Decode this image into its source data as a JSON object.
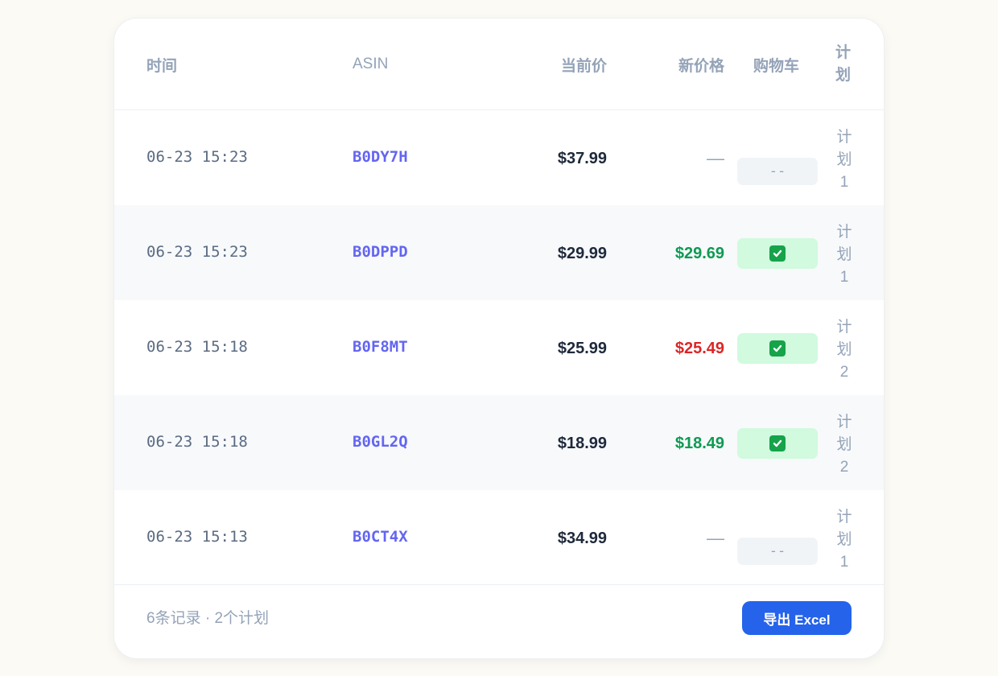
{
  "table": {
    "headers": {
      "time": "时间",
      "asin": "ASIN",
      "current_price": "当前价",
      "new_price": "新价格",
      "cart": "购物车",
      "plan": "计划"
    },
    "rows": [
      {
        "time": "06-23 15:23",
        "asin": "B0DY7H",
        "current_price": "$37.99",
        "new_price": "—",
        "new_price_status": "none",
        "cart": "--",
        "cart_status": "none",
        "plan": "计划1"
      },
      {
        "time": "06-23 15:23",
        "asin": "B0DPPD",
        "current_price": "$29.99",
        "new_price": "$29.69",
        "new_price_status": "green",
        "cart": "check",
        "cart_status": "yes",
        "plan": "计划1"
      },
      {
        "time": "06-23 15:18",
        "asin": "B0F8MT",
        "current_price": "$25.99",
        "new_price": "$25.49",
        "new_price_status": "red",
        "cart": "check",
        "cart_status": "yes",
        "plan": "计划2"
      },
      {
        "time": "06-23 15:18",
        "asin": "B0GL2Q",
        "current_price": "$18.99",
        "new_price": "$18.49",
        "new_price_status": "green",
        "cart": "check",
        "cart_status": "yes",
        "plan": "计划2"
      },
      {
        "time": "06-23 15:13",
        "asin": "B0CT4X",
        "current_price": "$34.99",
        "new_price": "—",
        "new_price_status": "none",
        "cart": "--",
        "cart_status": "none",
        "plan": "计划1"
      }
    ]
  },
  "footer": {
    "summary": "6条记录 · 2个计划",
    "export_label": "导出 Excel"
  },
  "colors": {
    "accent": "#2563eb",
    "asin": "#6366f1",
    "price_up": "#0f9a52",
    "price_down": "#dc2626",
    "cart_yes_bg": "#d1fadf"
  },
  "icons": {
    "cart_yes": "check-box-icon"
  }
}
